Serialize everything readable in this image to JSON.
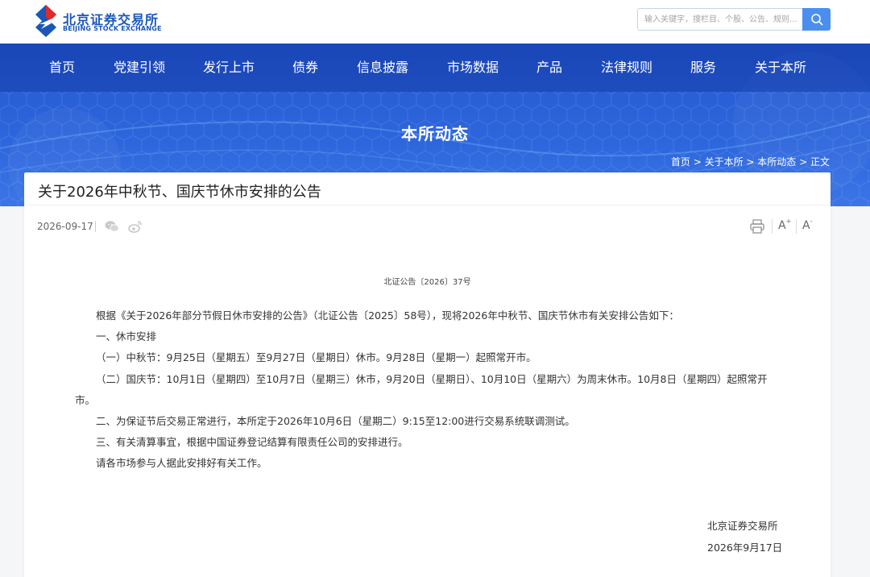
{
  "logo": {
    "cn": "北京证券交易所",
    "en": "BEIJING STOCK EXCHANGE"
  },
  "search": {
    "placeholder": "输入关键字，搜栏目、个股、公告、规则..."
  },
  "nav": {
    "items": [
      "首页",
      "党建引领",
      "发行上市",
      "债券",
      "信息披露",
      "市场数据",
      "产品",
      "法律规则",
      "服务",
      "关于本所"
    ]
  },
  "banner": {
    "title": "本所动态"
  },
  "breadcrumb": {
    "items": [
      "首页",
      "关于本所",
      "本所动态",
      "正文"
    ],
    "sep": " > "
  },
  "article": {
    "title": "关于2026年中秋节、国庆节休市安排的公告",
    "date": "2026-09-17",
    "font_up": "A",
    "font_down": "A",
    "doc_no": "北证公告〔2026〕37号",
    "paragraphs": [
      "根据《关于2026年部分节假日休市安排的公告》（北证公告〔2025〕58号），现将2026年中秋节、国庆节休市有关安排公告如下：",
      "一、休市安排",
      "（一）中秋节：9月25日（星期五）至9月27日（星期日）休市。9月28日（星期一）起照常开市。",
      "（二）国庆节：10月1日（星期四）至10月7日（星期三）休市，9月20日（星期日）、10月10日（星期六）为周末休市。10月8日（星期四）起照常开",
      "市。",
      "二、为保证节后交易正常进行，本所定于2026年10月6日（星期二）9:15至12:00进行交易系统联调测试。",
      "三、有关清算事宜，根据中国证券登记结算有限责任公司的安排进行。",
      "请各市场参与人据此安排好有关工作。"
    ],
    "signature": "北京证券交易所",
    "sign_date": "2026年9月17日"
  },
  "icons": {
    "wechat": "wechat-icon",
    "weibo": "weibo-icon",
    "print": "print-icon",
    "search": "search-icon"
  },
  "colors": {
    "brand_blue": "#1a57b8",
    "banner_blue": "#2a5fd6",
    "search_button": "#4a8ff0"
  }
}
